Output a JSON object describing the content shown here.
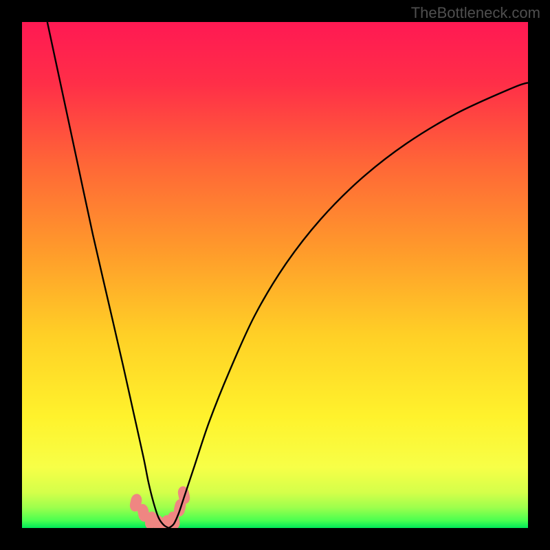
{
  "watermark": "TheBottleneck.com",
  "chart_data": {
    "type": "line",
    "title": "",
    "xlabel": "",
    "ylabel": "",
    "xlim": [
      0,
      100
    ],
    "ylim": [
      0,
      100
    ],
    "grid": false,
    "note": "Background is a vertical gradient from red (top) through orange/yellow to bright green (bottom). Two black curves start high on left/right, dip to a minimum near x≈26 forming a narrow V touching the bottom. Salmon-colored lumpy markers sit along the bottom of the V.",
    "series": [
      {
        "name": "left-curve",
        "x": [
          5,
          8,
          11,
          14,
          17,
          20,
          22,
          24,
          25,
          26,
          27,
          28,
          29
        ],
        "y": [
          100,
          86,
          72,
          58,
          45,
          32,
          23,
          14,
          9,
          5,
          2,
          0.6,
          0
        ]
      },
      {
        "name": "right-curve",
        "x": [
          29,
          30,
          31,
          32,
          34,
          37,
          41,
          46,
          52,
          59,
          67,
          76,
          86,
          97,
          100
        ],
        "y": [
          0,
          0.8,
          3,
          6,
          12,
          21,
          31,
          42,
          52,
          61,
          69,
          76,
          82,
          87,
          88
        ]
      },
      {
        "name": "salmon-markers",
        "x": [
          22.5,
          24.0,
          25.5,
          27.0,
          28.5,
          30.0,
          31.2,
          32.0
        ],
        "y": [
          5.0,
          3.0,
          1.5,
          0.8,
          0.8,
          1.5,
          4.0,
          6.5
        ]
      }
    ],
    "gradient_stops": [
      {
        "offset": 0.0,
        "color": "#ff1953"
      },
      {
        "offset": 0.12,
        "color": "#ff2e48"
      },
      {
        "offset": 0.28,
        "color": "#ff6637"
      },
      {
        "offset": 0.45,
        "color": "#ff9a2b"
      },
      {
        "offset": 0.62,
        "color": "#ffd026"
      },
      {
        "offset": 0.78,
        "color": "#fff22c"
      },
      {
        "offset": 0.88,
        "color": "#f7ff47"
      },
      {
        "offset": 0.93,
        "color": "#d4ff4a"
      },
      {
        "offset": 0.96,
        "color": "#9cff4d"
      },
      {
        "offset": 0.985,
        "color": "#4bff50"
      },
      {
        "offset": 1.0,
        "color": "#00e858"
      }
    ],
    "colors": {
      "curve": "#000000",
      "marker": "#ef8682",
      "background_frame": "#000000"
    }
  }
}
